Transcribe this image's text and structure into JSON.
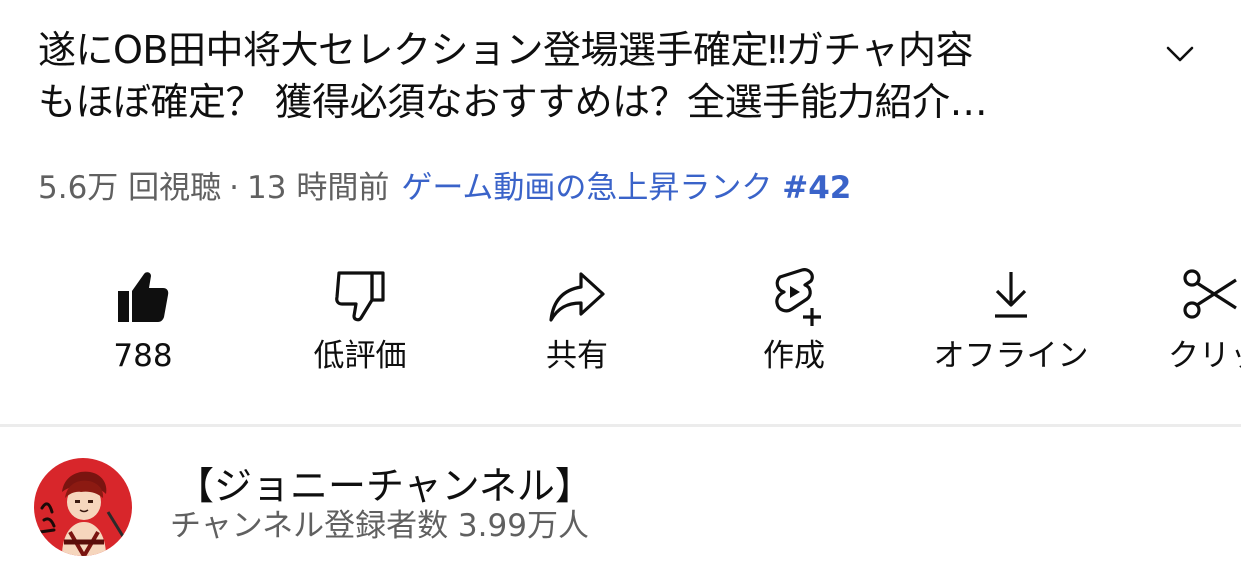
{
  "video": {
    "title_line1": "遂にOB田中将大セレクション登場選手確定‼ガチャ内容",
    "title_line2": "もほぼ確定？ 獲得必須なおすすめは？全選手能力紹介…",
    "views": "5.6万 回視聴",
    "separator": "·",
    "posted": "13 時間前",
    "trending_label": "ゲーム動画の急上昇ランク",
    "trending_rank": "#42"
  },
  "actions": [
    {
      "label": "788",
      "icon": "thumbs-up-filled-icon"
    },
    {
      "label": "低評価",
      "icon": "thumbs-down-icon"
    },
    {
      "label": "共有",
      "icon": "share-arrow-icon"
    },
    {
      "label": "作成",
      "icon": "create-shorts-icon"
    },
    {
      "label": "オフライン",
      "icon": "download-icon"
    },
    {
      "label": "クリッ",
      "icon": "scissors-clip-icon"
    }
  ],
  "channel": {
    "name": "【ジョニーチャンネル】",
    "subscribers": "チャンネル登録者数 3.99万人",
    "avatar_icon": "channel-avatar-icon"
  },
  "colors": {
    "text_primary": "#0f0f0f",
    "text_secondary": "#606060",
    "trending_link": "#3a63c9",
    "divider": "#ececec",
    "avatar_bg": "#d8262b"
  }
}
